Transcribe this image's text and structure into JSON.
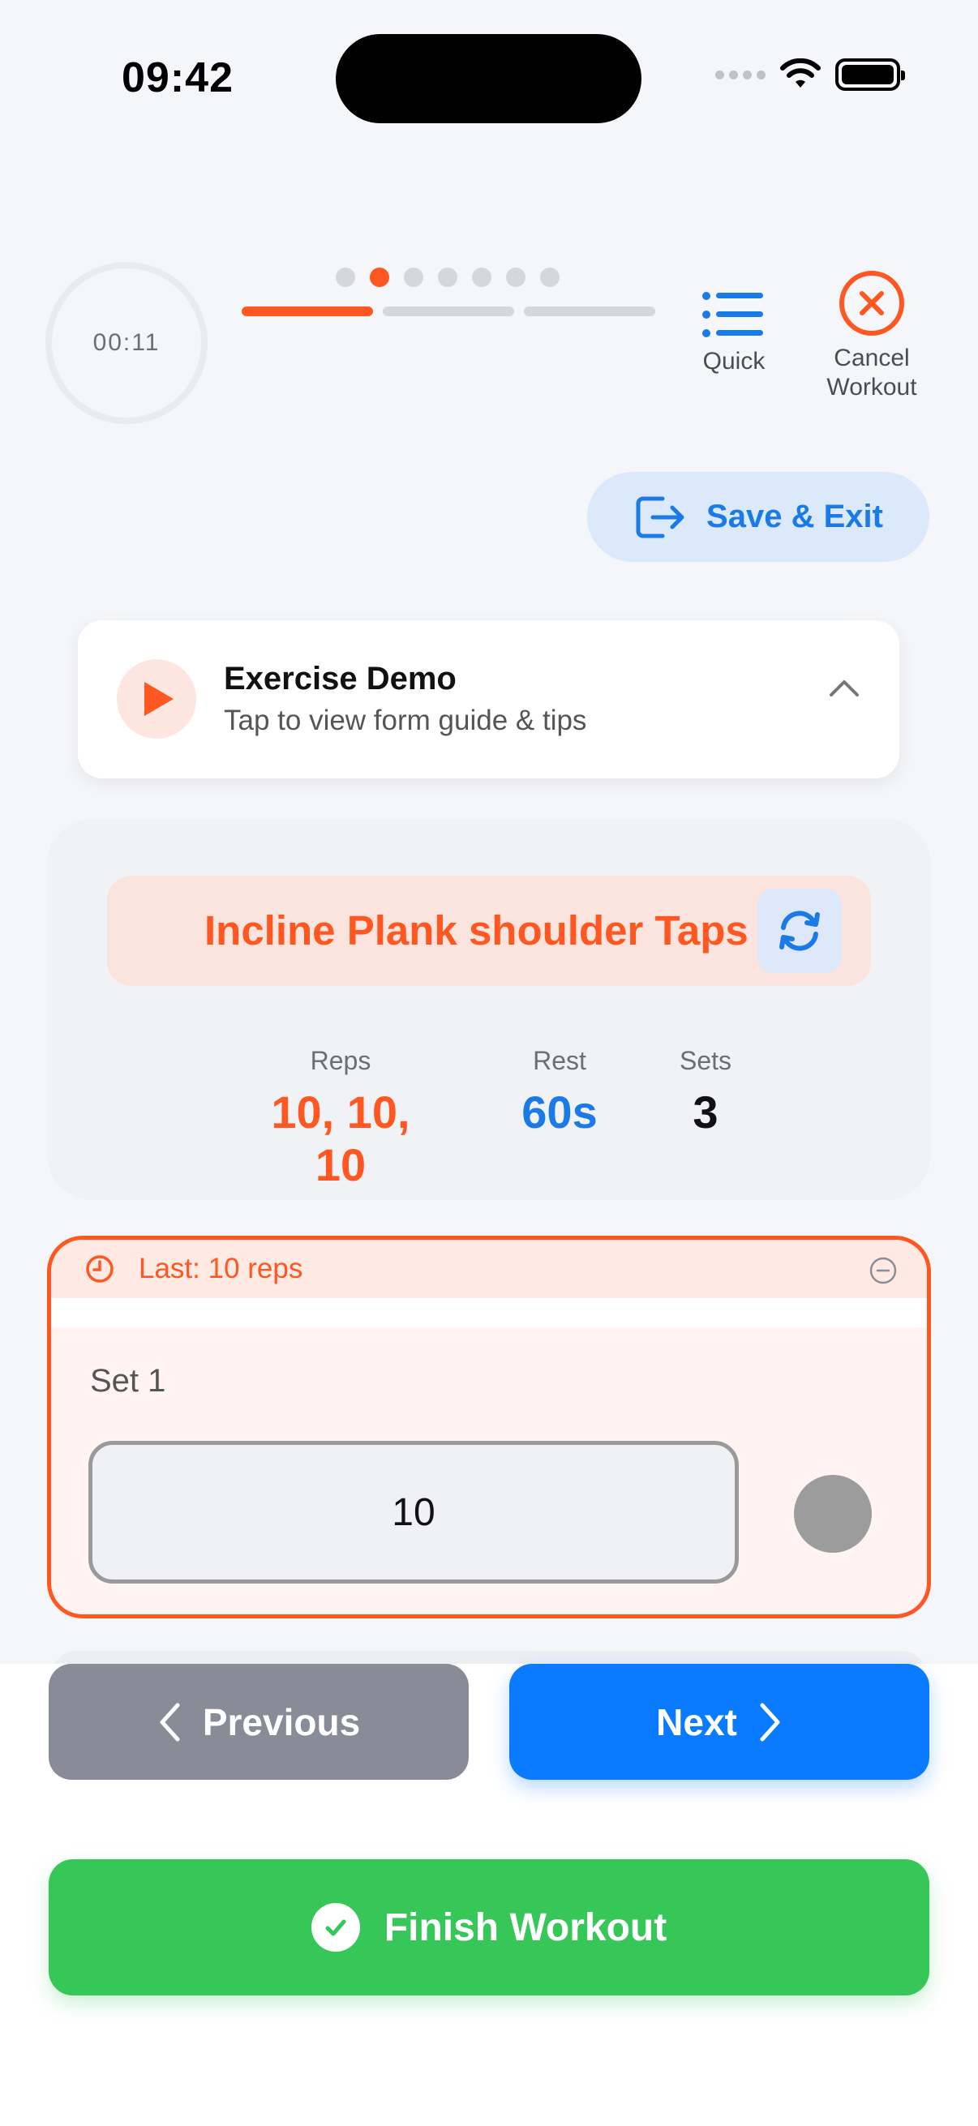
{
  "status_bar": {
    "time": "09:42"
  },
  "timer": {
    "elapsed": "00:11"
  },
  "progress": {
    "total_exercises": 7,
    "current_index": 1,
    "total_segments": 3,
    "current_segment": 0
  },
  "header": {
    "quick_label": "Quick",
    "cancel_label_line1": "Cancel",
    "cancel_label_line2": "Workout",
    "save_exit_label": "Save & Exit"
  },
  "demo": {
    "title": "Exercise Demo",
    "subtitle": "Tap to view form guide & tips"
  },
  "exercise": {
    "name": "Incline Plank shoulder Taps",
    "stats": {
      "reps_label": "Reps",
      "reps_value": "10, 10, 10",
      "rest_label": "Rest",
      "rest_value": "60s",
      "sets_label": "Sets",
      "sets_value": "3"
    }
  },
  "set": {
    "last_text": "Last: 10 reps",
    "label": "Set 1",
    "reps_value": "10"
  },
  "nav": {
    "previous_label": "Previous",
    "next_label": "Next"
  },
  "finish": {
    "label": "Finish Workout"
  },
  "colors": {
    "accent": "#ff5722",
    "blue": "#0a7bff",
    "green": "#36c758",
    "grey_button": "#888c96"
  }
}
